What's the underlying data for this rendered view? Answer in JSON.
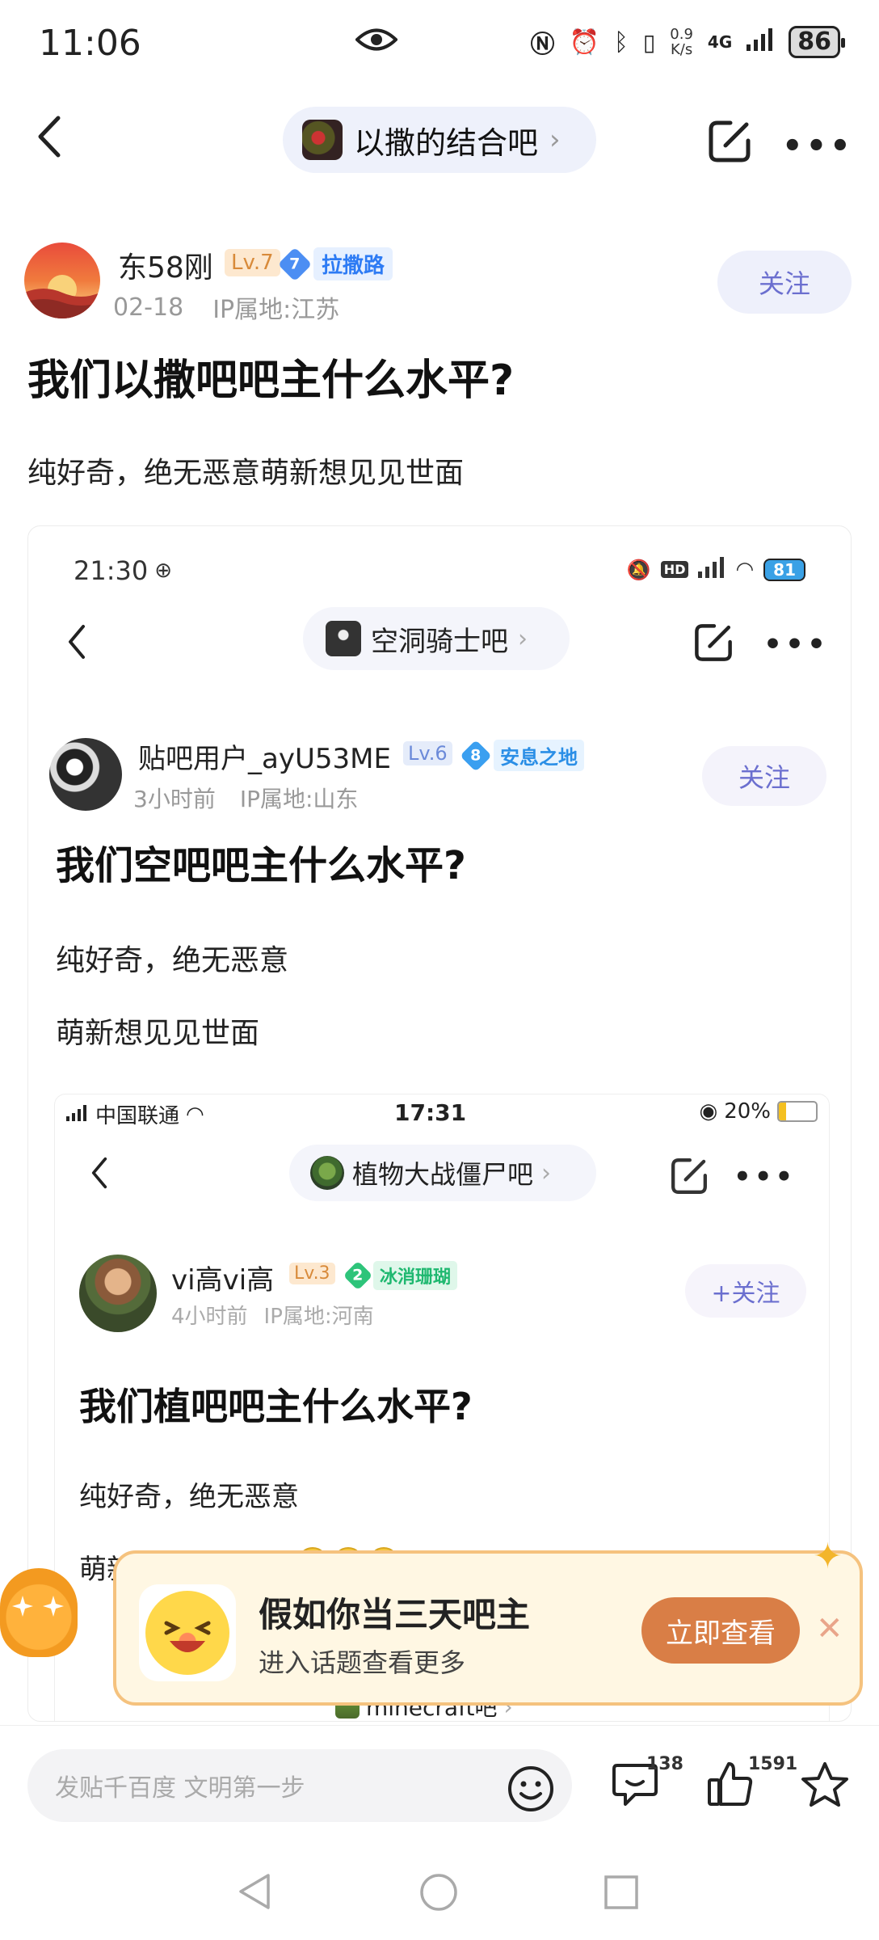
{
  "status_bar": {
    "time": "11:06",
    "net_speed_top": "0.9",
    "net_speed_bottom": "K/s",
    "network": "4G",
    "battery": "86"
  },
  "nav": {
    "forum_name": "以撒的结合吧"
  },
  "post": {
    "author": "东58刚",
    "level": "Lv.7",
    "badge_num": "7",
    "badge_text": "拉撒路",
    "date": "02-18",
    "ip": "IP属地:江苏",
    "follow": "关注",
    "title": "我们以撒吧吧主什么水平?",
    "body": "纯好奇，绝无恶意萌新想见见世面"
  },
  "embed1": {
    "time": "21:30",
    "battery": "81",
    "forum_name": "空洞骑士吧",
    "author": "贴吧用户_ayU53ME",
    "level": "Lv.6",
    "badge_num": "8",
    "badge_text": "安息之地",
    "time_ago": "3小时前",
    "ip": "IP属地:山东",
    "follow": "关注",
    "title": "我们空吧吧主什么水平?",
    "body1": "纯好奇，绝无恶意",
    "body2": "萌新想见见世面"
  },
  "embed2": {
    "carrier": "中国联通",
    "time": "17:31",
    "battery": "20%",
    "forum_name": "植物大战僵尸吧",
    "author": "vi高vi高",
    "level": "Lv.3",
    "badge_num": "2",
    "badge_text": "冰消珊瑚",
    "time_ago": "4小时前",
    "ip": "IP属地:河南",
    "follow": "+关注",
    "title": "我们植吧吧主什么水平?",
    "body1": "纯好奇，绝无恶意",
    "body2": "萌新想见见世面"
  },
  "embed3": {
    "forum_name": "minecraft吧"
  },
  "popup": {
    "title": "假如你当三天吧主",
    "subtitle": "进入话题查看更多",
    "button": "立即查看"
  },
  "bottom_bar": {
    "placeholder": "发贴千百度 文明第一步",
    "comment_count": "138",
    "like_count": "1591"
  },
  "icons": [
    "back-icon",
    "eye-icon",
    "edit-icon",
    "more-icon",
    "emoji-icon",
    "comment-icon",
    "like-icon",
    "star-icon",
    "close-icon"
  ],
  "colors": {
    "accent": "#6b6fcf",
    "popup_button": "#d97e46",
    "popup_bg": "#fff7e3"
  }
}
